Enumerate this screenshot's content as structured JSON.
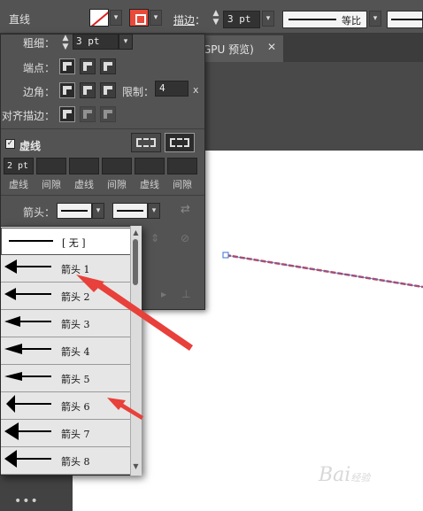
{
  "control_bar": {
    "title": "直线",
    "stroke_label": "描边",
    "stroke_value": "3 pt",
    "profile_label": "等比"
  },
  "document": {
    "tab_label": "GPU 预览)",
    "close_glyph": "✕"
  },
  "stroke_panel": {
    "weight_label": "粗细：",
    "weight_value": "3 pt",
    "cap_label": "端点：",
    "corner_label": "边角：",
    "limit_label": "限制：",
    "limit_value": "4",
    "limit_unit": "x",
    "align_label": "对齐描边：",
    "dashed_label": "虚线",
    "dashed_checked": true,
    "dash_values": [
      "2 pt",
      "",
      "",
      "",
      "",
      ""
    ],
    "dash_labels": [
      "虚线",
      "间隙",
      "虚线",
      "间隙",
      "虚线",
      "间隙"
    ],
    "arrowhead_label": "箭头："
  },
  "arrowhead_menu": {
    "items": [
      {
        "label": "[ 无 ]",
        "icon": "no-arrow-icon"
      },
      {
        "label": "箭头 1",
        "icon": "arrow-1-icon"
      },
      {
        "label": "箭头 2",
        "icon": "arrow-2-icon"
      },
      {
        "label": "箭头 3",
        "icon": "arrow-3-icon"
      },
      {
        "label": "箭头 4",
        "icon": "arrow-4-icon"
      },
      {
        "label": "箭头 5",
        "icon": "arrow-5-icon"
      },
      {
        "label": "箭头 6",
        "icon": "arrow-6-icon"
      },
      {
        "label": "箭头 7",
        "icon": "arrow-7-icon"
      },
      {
        "label": "箭头 8",
        "icon": "arrow-8-icon"
      }
    ]
  },
  "colors": {
    "annotation_arrow": "#e8403a",
    "line_stroke": "#d94040",
    "line_highlight": "#3a6fd8",
    "panel_bg": "#535353",
    "menu_bg": "#e6e6e6"
  },
  "watermark": {
    "text": "Bai",
    "sub": "经验"
  },
  "status": {
    "more_glyph": "•••"
  }
}
